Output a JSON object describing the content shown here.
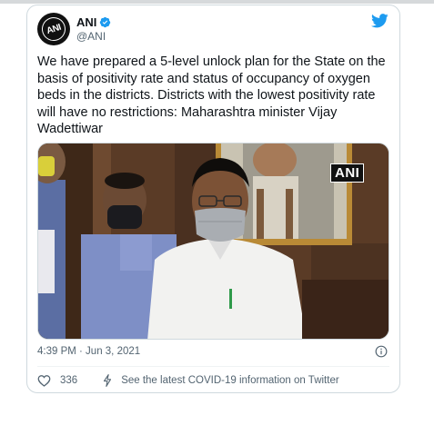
{
  "tweet": {
    "author": {
      "display_name": "ANI",
      "handle": "@ANI",
      "avatar_text": "ANI",
      "verified": true
    },
    "text": "We have prepared a 5-level unlock plan for the State on the basis of positivity rate and status of occupancy of oxygen beds in the districts. Districts with the lowest positivity rate will have no restrictions: Maharashtra minister Vijay Wadettiwar",
    "media": {
      "watermark": "ANI"
    },
    "timestamp": "4:39 PM · Jun 3, 2021",
    "likes": "336",
    "covid_info_link": "See the latest COVID-19 information on Twitter"
  },
  "colors": {
    "twitter_blue": "#1d9bf0",
    "text_primary": "#0f1419",
    "text_secondary": "#536471",
    "border": "#cfd9de"
  },
  "icons": {
    "brand": "twitter-bird-icon",
    "verified": "verified-badge-icon",
    "info": "info-icon",
    "like": "heart-icon",
    "covid": "lightning-bolt-icon"
  }
}
